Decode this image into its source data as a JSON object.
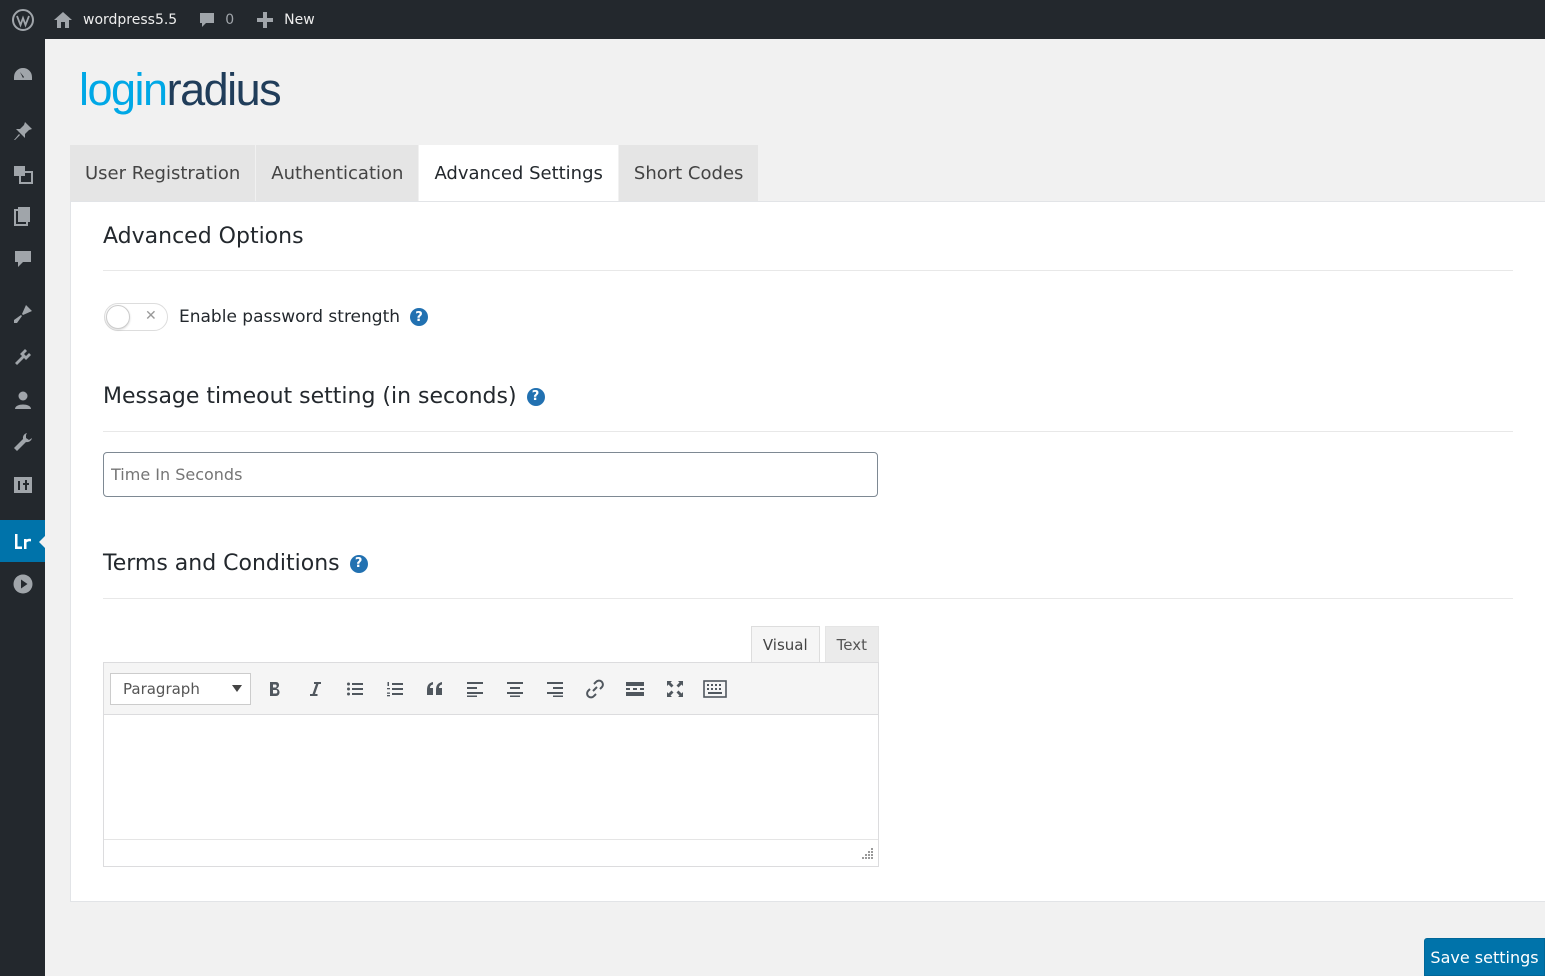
{
  "admin_bar": {
    "logo_icon": "wordpress-icon",
    "site_name": "wordpress5.5",
    "comments_count": "0",
    "new_label": "New"
  },
  "sidebar": {
    "items": [
      {
        "icon": "dashboard-icon"
      },
      {
        "icon": "pin-icon"
      },
      {
        "icon": "media-icon"
      },
      {
        "icon": "pages-icon"
      },
      {
        "icon": "comments-icon"
      },
      {
        "icon": "appearance-icon"
      },
      {
        "icon": "plugins-icon"
      },
      {
        "icon": "users-icon"
      },
      {
        "icon": "tools-icon"
      },
      {
        "icon": "settings-icon"
      },
      {
        "icon": "loginradius-icon",
        "current": true
      },
      {
        "icon": "play-icon"
      }
    ]
  },
  "logo": {
    "part_a": "login",
    "part_b": "radius"
  },
  "tabs": [
    {
      "label": "User Registration"
    },
    {
      "label": "Authentication"
    },
    {
      "label": "Advanced Settings",
      "active": true
    },
    {
      "label": "Short Codes"
    }
  ],
  "advanced": {
    "title": "Advanced Options",
    "password_toggle_label": "Enable password strength",
    "password_toggle_on": false,
    "help_glyph": "?"
  },
  "timeout": {
    "title": "Message timeout setting (in seconds)",
    "value": "",
    "placeholder": "Time In Seconds"
  },
  "terms": {
    "title": "Terms and Conditions",
    "editor": {
      "visual_tab": "Visual",
      "text_tab": "Text",
      "format_value": "Paragraph",
      "content": ""
    }
  },
  "save_label": "Save settings",
  "colors": {
    "accent": "#0073aa",
    "help": "#2271b1",
    "logo_light": "#00a8e6",
    "logo_dark": "#203d5a"
  }
}
